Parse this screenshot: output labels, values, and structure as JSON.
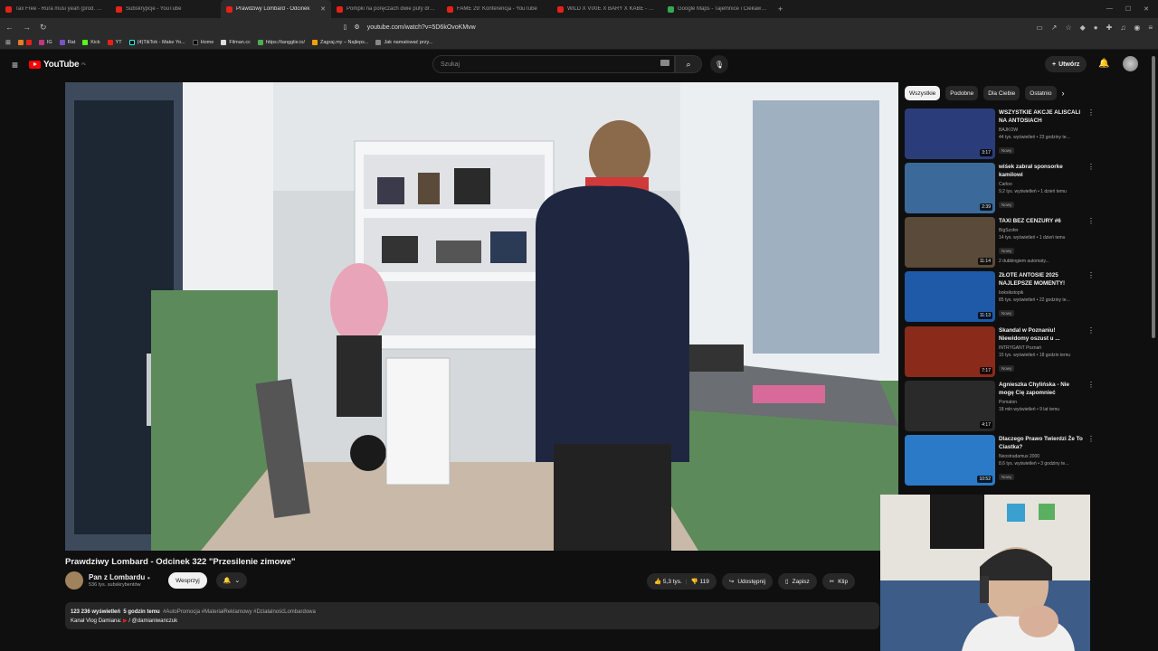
{
  "tabs": [
    {
      "title": "Tax Free - Rura musi yeah (prod. CL..."
    },
    {
      "title": "Subskrypcje - YouTube"
    },
    {
      "title": "Prawdziwy Lombard - Odcinek",
      "active": true
    },
    {
      "title": "Pompki na poręczach dwie pufy dron..."
    },
    {
      "title": "FAME 29: Konferencja - YouTube"
    },
    {
      "title": "WILD X VIXIE X BARY X KABE - SZL4..."
    },
    {
      "title": "Google Maps - Tajemnice i Ciekawos..."
    }
  ],
  "address": {
    "url": "youtube.com/watch?v=5D6kOvoKMvw"
  },
  "bookmarks": [
    "IG",
    "Rat",
    "Kick",
    "YT",
    "(4)TikTok - Make Yo...",
    "Home",
    "Filman.cc",
    "https://tangglie.io/",
    "Zagraj.my – Najleps...",
    "Jak namalować przy..."
  ],
  "header": {
    "logo_text": "YouTube",
    "logo_country": "PL",
    "search_placeholder": "Szukaj",
    "create_label": "Utwórz"
  },
  "video": {
    "title": "Prawdziwy Lombard - Odcinek 322 \"Przesilenie zimowe\"",
    "channel": "Pan z Lombardu",
    "subscribers": "536 tys. subskrybentów",
    "support_label": "Wesprzyj",
    "likes": "5,3 tys.",
    "dislikes": "119",
    "share_label": "Udostępnij",
    "save_label": "Zapisz",
    "clip_label": "Klip",
    "views": "123 236 wyświetleń",
    "age": "5 godzin temu",
    "tags": "#AutoPromocja #MateriałReklamowy #DziałalnośćLombardowa",
    "desc_line2_prefix": "Kanał Vlog Damiana:",
    "desc_line2_link": "/ @damianiwanczuk"
  },
  "chips": [
    "Wszystkie",
    "Podobne",
    "Dla Ciebie",
    "Ostatnio"
  ],
  "recommendations": [
    {
      "title": "WSZYSTKIE AKCJE ALISCALI NA ANTOSIACH",
      "channel": "BAJKOW",
      "views": "44 tys. wyświetleń • 23 godziny te...",
      "badge": "Nowy",
      "duration": "3:17",
      "color": "#2a3d7a"
    },
    {
      "title": "wiśek zabrał sponsorke kamilowi",
      "channel": "Carloo",
      "views": "9,2 tys. wyświetleń • 1 dzień temu",
      "badge": "Nowy",
      "duration": "2:39",
      "color": "#3b6a9a"
    },
    {
      "title": "TAXI BEZ CENZURY #6",
      "channel": "BigSzofer",
      "views": "14 tys. wyświetleń • 1 dzień temu",
      "badge": "Nowy",
      "extra": "2 dubbingiem automaty...",
      "duration": "11:14",
      "color": "#5a4a3a"
    },
    {
      "title": "ZŁOTE ANTOSIE 2025 NAJLEPSZE MOMENTY!",
      "channel": "boksikstopik",
      "views": "85 tys. wyświetleń • 22 godziny te...",
      "badge": "Nowy",
      "duration": "11:13",
      "color": "#1e5aa8"
    },
    {
      "title": "Skandal w Poznaniu! Niewidomy oszust u ...",
      "channel": "INTRYGANT Poznań",
      "views": "15 tys. wyświetleń • 18 godzin temu",
      "badge": "Nowy",
      "duration": "7:17",
      "color": "#8a2a1a"
    },
    {
      "title": "Agnieszka Chylińska - Nie mogę Cię zapomnieć",
      "channel": "Pomaton",
      "views": "18 mln wyświetleń • 9 lat temu",
      "badge": "",
      "duration": "4:17",
      "color": "#2a2a2a"
    },
    {
      "title": "Dlaczego Prawo Twierdzi Że To Ciastka?",
      "channel": "Neostradamus 2000",
      "views": "8,6 tys. wyświetleń • 3 godziny te...",
      "badge": "Nowy",
      "duration": "10:52",
      "color": "#2a7ac8"
    }
  ]
}
